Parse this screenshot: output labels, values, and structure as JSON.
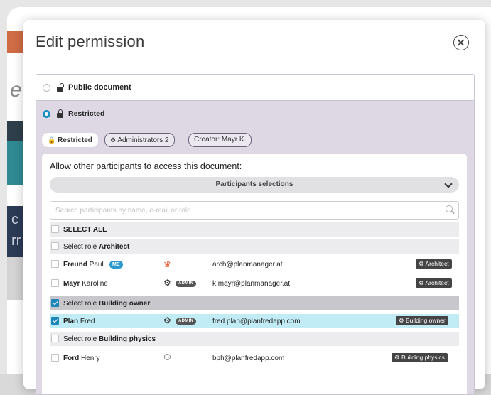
{
  "background": {
    "letter": "e",
    "letters": [
      "c",
      "rr"
    ],
    "colors": {
      "stripe": "#cf6b45",
      "dark": "#2e3f4b",
      "teal": "#2f8a93",
      "navy": "#2b3a55"
    }
  },
  "modal": {
    "title": "Edit permission",
    "close_icon": "close-circle-icon"
  },
  "options": {
    "public_label": "Public document",
    "restricted_label": "Restricted",
    "selected": "restricted"
  },
  "chips": {
    "restricted": "Restricted",
    "administrators": "Administrators 2",
    "creator": "Creator: Mayr K."
  },
  "access": {
    "heading": "Allow other participants to access this document:",
    "participants_selection": "Participants selections",
    "search_placeholder": "Search participants by name, e-mail or role"
  },
  "list": {
    "select_all": "SELECT ALL",
    "role_architect_prefix": "Select role ",
    "role_architect": "Architect",
    "role_owner_prefix": "Select role ",
    "role_owner": "Building owner",
    "role_physics_prefix": "Select role ",
    "role_physics": "Building physics",
    "users": [
      {
        "last": "Freund",
        "first": "Paul",
        "badge": "ME",
        "email": "arch@planmanager.at",
        "role": "Architect",
        "checked": false
      },
      {
        "last": "Mayr",
        "first": "Karoline",
        "badge": "ADMIN",
        "email": "k.mayr@planmanager.at",
        "role": "Architect",
        "checked": false
      },
      {
        "last": "Plan",
        "first": "Fred",
        "badge": "ADMIN",
        "email": "fred.plan@planfredapp.com",
        "role": "Building owner",
        "checked": true
      },
      {
        "last": "Ford",
        "first": "Henry",
        "badge": "",
        "email": "bph@planfredapp.com",
        "role": "Building physics",
        "checked": false
      }
    ]
  },
  "colors": {
    "accent": "#1f86b8",
    "selected_row": "#c1ecf5",
    "panel": "#ddd8e4",
    "me_badge": "#2c9ad1",
    "crown": "#e0431d"
  }
}
